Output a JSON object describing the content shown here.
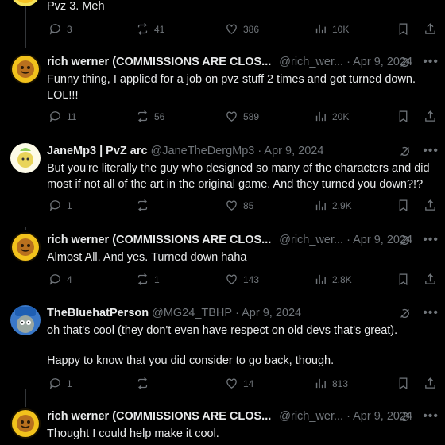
{
  "posts": [
    {
      "text": "Pvz 3. Meh",
      "stats": {
        "replies": "3",
        "reposts": "41",
        "likes": "386",
        "views": "10K"
      }
    },
    {
      "name": "rich werner (COMMISSIONS ARE CLOS...",
      "handle": "@rich_wer...",
      "date": "· Apr 9, 2024",
      "text": "Funny thing, I applied for a job on pvz stuff 2 times and got turned down. LOL!!!",
      "stats": {
        "replies": "11",
        "reposts": "56",
        "likes": "589",
        "views": "20K"
      }
    },
    {
      "name": "JaneMp3 | PvZ arc",
      "handle": "@JaneTheDergMp3",
      "date": "· Apr 9, 2024",
      "text": "But you're literally the guy who designed so many of the characters and did most if not all of the art in the original game. And they turned you down?!?",
      "stats": {
        "replies": "1",
        "reposts": "",
        "likes": "85",
        "views": "2.9K"
      }
    },
    {
      "name": "rich werner (COMMISSIONS ARE CLOS...",
      "handle": "@rich_wer...",
      "date": "· Apr 9, 2024",
      "text": "Almost All. And yes.  Turned down haha",
      "stats": {
        "replies": "4",
        "reposts": "1",
        "likes": "143",
        "views": "2.8K"
      }
    },
    {
      "name": "TheBluehatPerson",
      "handle": "@MG24_TBHP",
      "date": "· Apr 9, 2024",
      "text": "oh that's cool (they don't even have respect on old devs that's great).",
      "text2": "Happy to know that you did consider to go back, though.",
      "stats": {
        "replies": "1",
        "reposts": "",
        "likes": "14",
        "views": "813"
      }
    },
    {
      "name": "rich werner (COMMISSIONS ARE CLOS...",
      "handle": "@rich_wer...",
      "date": "· Apr 9, 2024",
      "text": "Thought I could help make it cool."
    }
  ]
}
